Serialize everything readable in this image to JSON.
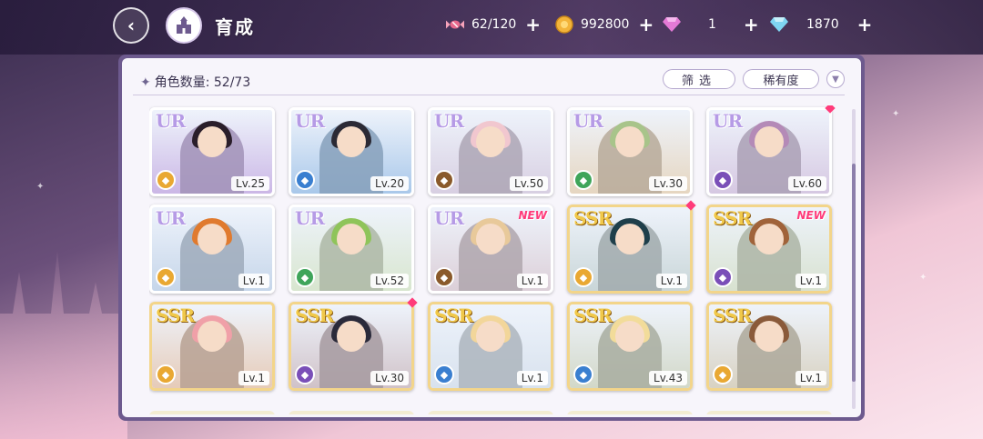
{
  "app": {
    "title": "育成"
  },
  "header": {
    "resources": [
      {
        "name": "candy",
        "icon": "candy-icon",
        "value": "62/120",
        "color": "#e96a8d"
      },
      {
        "name": "coin",
        "icon": "coin-icon",
        "value": "992800",
        "color": "#f3b43a"
      },
      {
        "name": "pink-gem",
        "icon": "pink-diamond-icon",
        "value": "1",
        "color": "#e47ad6"
      },
      {
        "name": "blue-gem",
        "icon": "blue-diamond-icon",
        "value": "1870",
        "color": "#7fd6f3"
      }
    ],
    "plus": "+"
  },
  "panel": {
    "count_label": "角色数量: 52/73",
    "filter_label": "筛选",
    "rarity_label": "稀有度",
    "cards": [
      {
        "rarity": "UR",
        "level": "Lv.25",
        "type_color": "#e9a832",
        "type_glyph": "◆",
        "hair": "#2a1e2a",
        "bg": "#cbb7e6",
        "new": "",
        "marker": false
      },
      {
        "rarity": "UR",
        "level": "Lv.20",
        "type_color": "#3a7fd0",
        "type_glyph": "◆",
        "hair": "#2b2a35",
        "bg": "#a9c8ea",
        "new": "",
        "marker": false
      },
      {
        "rarity": "UR",
        "level": "Lv.50",
        "type_color": "#8a5a2b",
        "type_glyph": "◆",
        "hair": "#f1c7cf",
        "bg": "#d8cfe2",
        "new": "",
        "marker": false
      },
      {
        "rarity": "UR",
        "level": "Lv.30",
        "type_color": "#3fa55a",
        "type_glyph": "◆",
        "hair": "#a8c48a",
        "bg": "#e6d6c0",
        "new": "",
        "marker": false
      },
      {
        "rarity": "UR",
        "level": "Lv.60",
        "type_color": "#7a4fb8",
        "type_glyph": "◆",
        "hair": "#b48ab7",
        "bg": "#d6c8e2",
        "new": "",
        "marker": true
      },
      {
        "rarity": "UR",
        "level": "Lv.1",
        "type_color": "#e9a832",
        "type_glyph": "◆",
        "hair": "#e07a2e",
        "bg": "#c6d6ea",
        "new": "",
        "marker": false
      },
      {
        "rarity": "UR",
        "level": "Lv.52",
        "type_color": "#3fa55a",
        "type_glyph": "◆",
        "hair": "#8fc45a",
        "bg": "#d8e6cf",
        "new": "",
        "marker": false
      },
      {
        "rarity": "UR",
        "level": "Lv.1",
        "type_color": "#8a5a2b",
        "type_glyph": "◆",
        "hair": "#e8c99a",
        "bg": "#dccfd8",
        "new": "NEW",
        "marker": false
      },
      {
        "rarity": "SSR",
        "level": "Lv.1",
        "type_color": "#e9a832",
        "type_glyph": "◆",
        "hair": "#1f3f4a",
        "bg": "#c9d6d8",
        "new": "",
        "marker": true
      },
      {
        "rarity": "SSR",
        "level": "Lv.1",
        "type_color": "#7a4fb8",
        "type_glyph": "◆",
        "hair": "#a0633a",
        "bg": "#d8e2d0",
        "new": "NEW",
        "marker": false
      },
      {
        "rarity": "SSR",
        "level": "Lv.1",
        "type_color": "#e9a832",
        "type_glyph": "◆",
        "hair": "#f0a0a8",
        "bg": "#e6cbb8",
        "new": "",
        "marker": false
      },
      {
        "rarity": "SSR",
        "level": "Lv.30",
        "type_color": "#7a4fb8",
        "type_glyph": "◆",
        "hair": "#2a2a3a",
        "bg": "#d0c2c8",
        "new": "",
        "marker": true
      },
      {
        "rarity": "SSR",
        "level": "Lv.1",
        "type_color": "#3a7fd0",
        "type_glyph": "◆",
        "hair": "#f2d69a",
        "bg": "#d8e2ee",
        "new": "",
        "marker": false
      },
      {
        "rarity": "SSR",
        "level": "Lv.43",
        "type_color": "#3a7fd0",
        "type_glyph": "◆",
        "hair": "#f2dc9a",
        "bg": "#d2d8c8",
        "new": "",
        "marker": false
      },
      {
        "rarity": "SSR",
        "level": "Lv.1",
        "type_color": "#e9a832",
        "type_glyph": "◆",
        "hair": "#8a5a3a",
        "bg": "#d8d2c2",
        "new": "",
        "marker": false
      }
    ]
  }
}
